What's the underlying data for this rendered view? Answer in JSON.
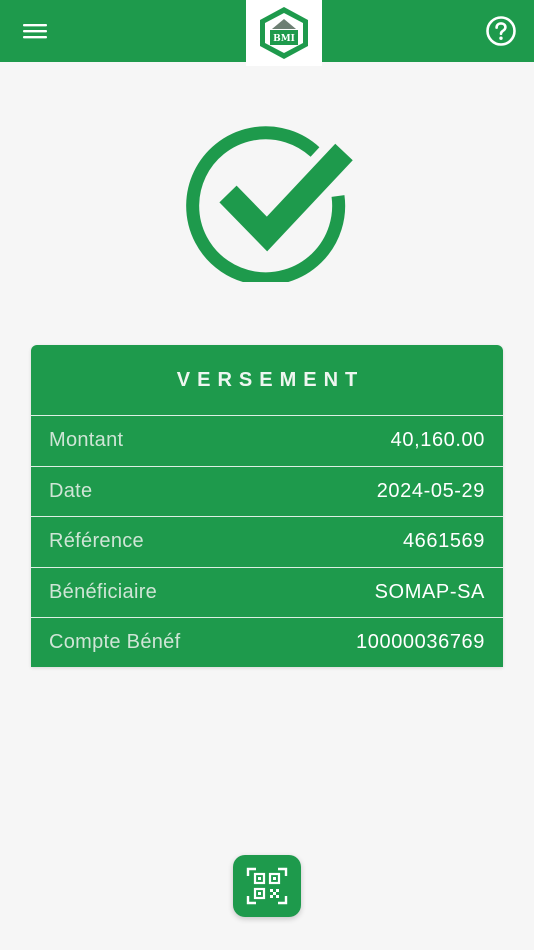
{
  "header": {
    "logo_text": "BMI"
  },
  "icons": {
    "menu": "menu-icon",
    "help": "help-icon",
    "success": "check-circle-icon",
    "qr": "qr-code-icon"
  },
  "colors": {
    "brand_green": "#1e9a4c",
    "background": "#f6f6f6",
    "white": "#ffffff"
  },
  "card": {
    "title": "VERSEMENT",
    "rows": [
      {
        "label": "Montant",
        "value": "40,160.00"
      },
      {
        "label": "Date",
        "value": "2024-05-29"
      },
      {
        "label": "Référence",
        "value": "4661569"
      },
      {
        "label": "Bénéficiaire",
        "value": "SOMAP-SA"
      },
      {
        "label": "Compte Bénéf",
        "value": "10000036769"
      }
    ]
  }
}
